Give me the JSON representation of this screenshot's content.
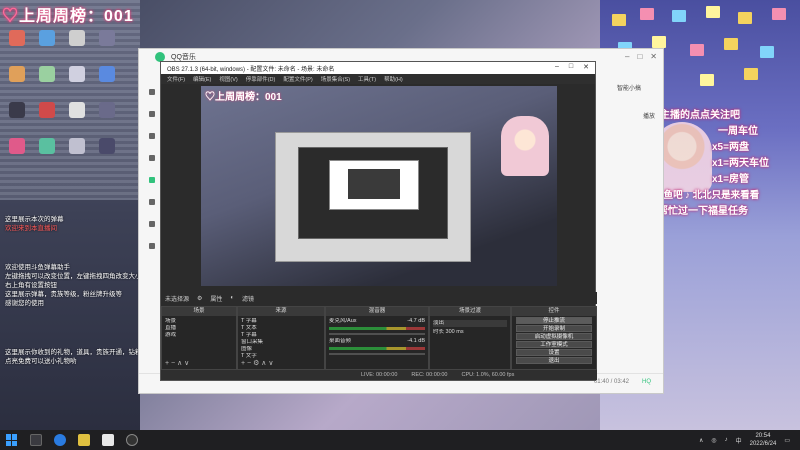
{
  "stream": {
    "title": "上周周榜：001",
    "heart": "♡"
  },
  "desktop_icons": [
    {
      "label": ""
    },
    {
      "label": ""
    },
    {
      "label": ""
    },
    {
      "label": ""
    },
    {
      "label": ""
    },
    {
      "label": ""
    },
    {
      "label": ""
    },
    {
      "label": ""
    },
    {
      "label": ""
    },
    {
      "label": ""
    },
    {
      "label": ""
    },
    {
      "label": ""
    },
    {
      "label": ""
    },
    {
      "label": ""
    },
    {
      "label": ""
    },
    {
      "label": ""
    }
  ],
  "chat": [
    {
      "text": "这里展示本次的弹幕",
      "highlight": false
    },
    {
      "text": "欢迎来到本直播间",
      "highlight": true
    },
    {
      "text": "欢迎使用斗鱼弹幕助手",
      "highlight": false
    },
    {
      "text": "左键拖拽可以改变位置，左键拖拽四角改变大小",
      "highlight": false
    },
    {
      "text": "右上角有设置按钮",
      "highlight": false
    },
    {
      "text": "这里展示弹幕，贵族等级，粉丝牌升级等",
      "highlight": false
    },
    {
      "text": "感谢您的使用",
      "highlight": false
    },
    {
      "text": "这里展示你收到的礼物，道具，贵族开通，钻粉开通等",
      "highlight": false
    },
    {
      "text": "点亮免费可以送小礼物哟",
      "highlight": false
    }
  ],
  "overlay": {
    "lines": [
      "喜欢主播的点点关注吧",
      "一周车位",
      "x5=两盘",
      "x1=两天车位",
      "x1=房管",
      "vx群在鱼吧",
      "北北只是来看看",
      "帮忙过一下福星任务"
    ]
  },
  "qq_music": {
    "title": "QQ音乐",
    "right_label": "智能小搞",
    "play_label": "播放",
    "time": "01:40 / 03:42",
    "quality": "HQ"
  },
  "obs": {
    "title": "OBS 27.1.3 (64-bit, windows) - 配置文件: 未命名 - 场景: 未命名",
    "menu": [
      "文件(F)",
      "编辑(E)",
      "视图(V)",
      "停靠部件(D)",
      "配置文件(P)",
      "场景集合(S)",
      "工具(T)",
      "帮助(H)"
    ],
    "preview_title": "♡上周周榜：001",
    "scene_bar": {
      "label": "未选择源",
      "props": "属性",
      "filters": "滤镜"
    },
    "docks": {
      "scenes": {
        "header": "场景",
        "items": [
          "场景",
          "直播",
          "游戏"
        ]
      },
      "sources": {
        "header": "来源",
        "items": [
          "T 字幕",
          "T 文本",
          "T 字幕",
          "窗口采集",
          "图像",
          "T 文字"
        ]
      },
      "mixer": {
        "header": "混音器",
        "tracks": [
          {
            "name": "麦克风/Aux",
            "db": "-4.7 dB"
          },
          {
            "name": "桌面音频",
            "db": "-4.1 dB"
          }
        ]
      },
      "transitions": {
        "header": "场景过渡",
        "type": "淡出",
        "duration_label": "时长",
        "duration": "300 ms"
      },
      "controls": {
        "header": "控件",
        "buttons": [
          "停止推流",
          "开始录制",
          "启动虚拟摄像机",
          "工作室模式",
          "设置",
          "退出"
        ]
      }
    },
    "status": {
      "live": "LIVE: 00:00:00",
      "rec": "REC: 00:00:00",
      "cpu": "CPU: 1.0%, 60.00 fps"
    }
  },
  "taskbar": {
    "lang": "中",
    "time": "20:54",
    "date": "2022/6/24"
  }
}
